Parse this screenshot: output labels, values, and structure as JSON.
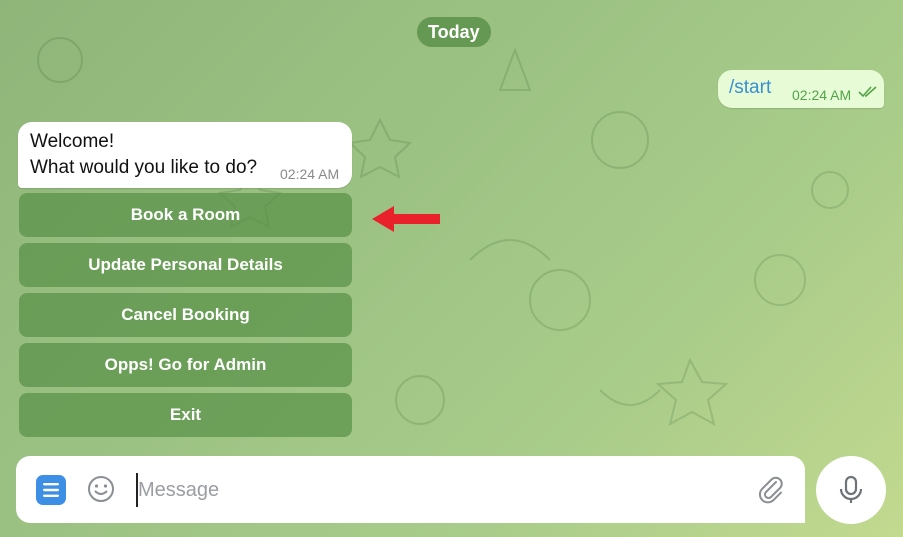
{
  "chat": {
    "date_label": "Today",
    "outgoing": {
      "text": "/start",
      "time": "02:24 AM"
    },
    "incoming": {
      "line1": "Welcome!",
      "line2": "What would you like to do?",
      "time": "02:24 AM"
    }
  },
  "keyboard": {
    "buttons": [
      "Book a Room",
      "Update Personal Details",
      "Cancel Booking",
      "Opps! Go for Admin",
      "Exit"
    ]
  },
  "composer": {
    "placeholder": "Message"
  },
  "icons": {
    "menu": "menu-icon",
    "emoji": "emoji-icon",
    "attach": "paperclip-icon",
    "mic": "microphone-icon",
    "arrow": "red-arrow-icon",
    "ticks": "double-check-icon"
  },
  "colors": {
    "accent": "#3d8fe6",
    "arrow": "#e8212b",
    "outgoing_bubble": "#e7fbd7"
  }
}
